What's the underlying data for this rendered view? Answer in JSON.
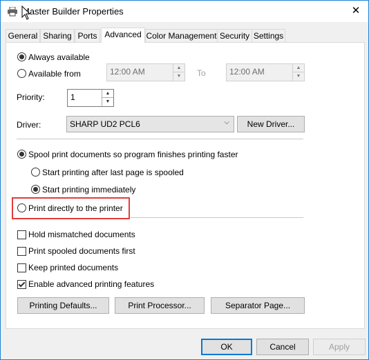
{
  "window": {
    "title": "Master Builder Properties",
    "close_glyph": "✕"
  },
  "tabs": [
    {
      "label": "General"
    },
    {
      "label": "Sharing"
    },
    {
      "label": "Ports"
    },
    {
      "label": "Advanced",
      "selected": true
    },
    {
      "label": "Color Management"
    },
    {
      "label": "Security"
    },
    {
      "label": "Settings"
    }
  ],
  "availability": {
    "always_label": "Always available",
    "from_label": "Available from",
    "from_time": "12:00 AM",
    "to_label": "To",
    "to_time": "12:00 AM"
  },
  "priority": {
    "label": "Priority:",
    "value": "1"
  },
  "driver": {
    "label": "Driver:",
    "value": "SHARP UD2 PCL6",
    "new_driver_label": "New Driver..."
  },
  "spooling": {
    "spool_label": "Spool print documents so program finishes printing faster",
    "after_last_page_label": "Start printing after last page is spooled",
    "immediately_label": "Start printing immediately",
    "direct_label": "Print directly to the printer"
  },
  "options": {
    "hold_mismatched": "Hold mismatched documents",
    "spooled_first": "Print spooled documents first",
    "keep_printed": "Keep printed documents",
    "advanced_features": "Enable advanced printing features"
  },
  "buttons": {
    "printing_defaults": "Printing Defaults...",
    "print_processor": "Print Processor...",
    "separator_page": "Separator Page...",
    "ok": "OK",
    "cancel": "Cancel",
    "apply": "Apply"
  },
  "colors": {
    "highlight": "#e23b3b",
    "accent": "#0078d7"
  }
}
